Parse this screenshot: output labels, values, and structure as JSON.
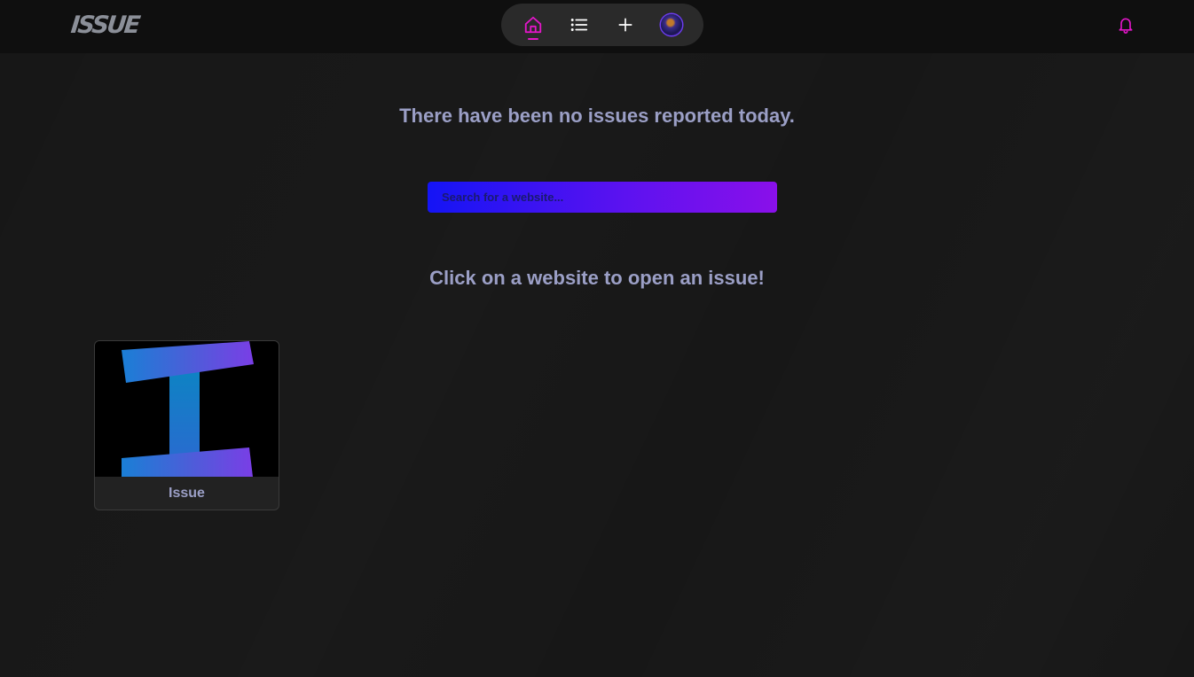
{
  "app": {
    "logo_text": "ISSUE"
  },
  "nav": {
    "items": [
      {
        "name": "home",
        "icon": "home-icon",
        "active": true
      },
      {
        "name": "list",
        "icon": "list-icon",
        "active": false
      },
      {
        "name": "add",
        "icon": "plus-icon",
        "active": false
      },
      {
        "name": "profile",
        "icon": "avatar",
        "active": false
      }
    ],
    "notifications_icon": "bell-icon"
  },
  "main": {
    "headline": "There have been no issues reported today.",
    "search": {
      "placeholder": "Search for a website...",
      "value": ""
    },
    "subheadline": "Click on a website to open an issue!",
    "websites": [
      {
        "name": "Issue",
        "icon": "issue-logo"
      }
    ]
  },
  "colors": {
    "accent": "#e316c9",
    "text_muted": "#9b9fc6",
    "search_gradient_start": "#1414f5",
    "search_gradient_end": "#8a10ea",
    "background": "#171717",
    "topbar": "#0f0f0f"
  }
}
